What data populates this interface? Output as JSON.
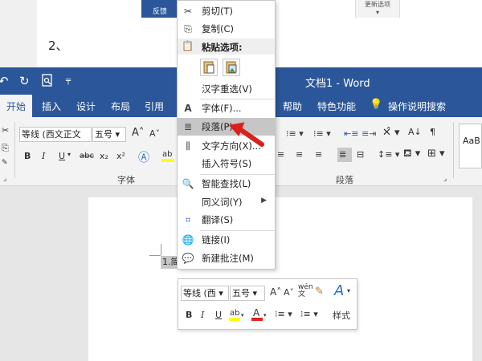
{
  "top_strip": {
    "tab_label": "反馈",
    "box_label": "更新选项",
    "list_number": "2、"
  },
  "title_bar": {
    "doc_title": "文档1  -  Word"
  },
  "tabs": [
    {
      "label": "开始",
      "active": true
    },
    {
      "label": "插入"
    },
    {
      "label": "设计"
    },
    {
      "label": "布局"
    },
    {
      "label": "引用"
    },
    {
      "label": "帮助"
    },
    {
      "label": "特色功能"
    },
    {
      "label": "操作说明搜索"
    }
  ],
  "ribbon": {
    "font_name": "等线 (西文正文",
    "font_size": "五号",
    "bold": "B",
    "italic": "I",
    "underline": "U",
    "strike": "abc",
    "subscript": "x₂",
    "superscript": "x²",
    "group_font": "字体",
    "group_paragraph": "段落",
    "styles_preview": "AaB"
  },
  "document": {
    "selected_text": "1.简"
  },
  "mini_toolbar": {
    "font_name": "等线 (西",
    "font_size": "五号",
    "bold": "B",
    "italic": "I",
    "underline": "U",
    "styles_label": "样式"
  },
  "context_menu": {
    "items": [
      {
        "label": "剪切(T)"
      },
      {
        "label": "复制(C)"
      },
      {
        "label": "粘贴选项:"
      },
      {
        "label": "汉字重选(V)"
      },
      {
        "label": "字体(F)..."
      },
      {
        "label": "段落(P)..."
      },
      {
        "label": "文字方向(X)..."
      },
      {
        "label": "插入符号(S)"
      },
      {
        "label": "智能查找(L)"
      },
      {
        "label": "同义词(Y)"
      },
      {
        "label": "翻译(S)"
      },
      {
        "label": "链接(I)"
      },
      {
        "label": "新建批注(M)"
      }
    ]
  },
  "colors": {
    "word_blue": "#2b579a",
    "ribbon_bg": "#f3f3f3",
    "hover_gray": "#c6c6c6",
    "arrow_red": "#d9201c"
  }
}
